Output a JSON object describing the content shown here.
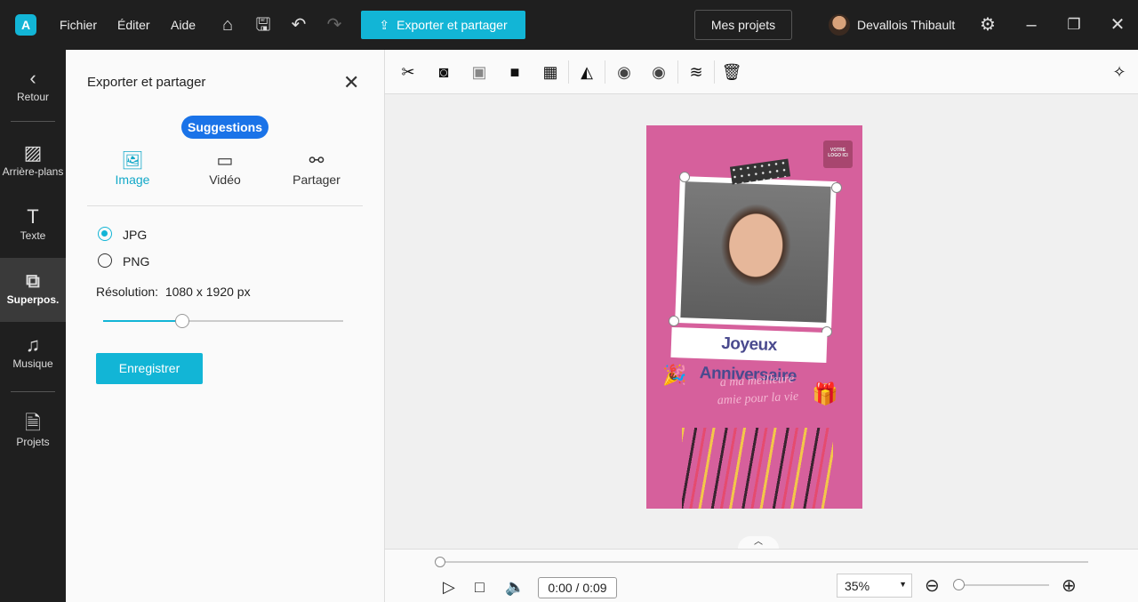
{
  "topbar": {
    "menu": [
      "Fichier",
      "Éditer",
      "Aide"
    ],
    "export_label": "Exporter et partager",
    "projects_label": "Mes projets",
    "user_name": "Devallois Thibault"
  },
  "sidebar": {
    "items": [
      {
        "label": "Retour",
        "icon": "chevron-left-icon"
      },
      {
        "label": "Arrière-plans",
        "icon": "hatch-icon"
      },
      {
        "label": "Texte",
        "icon": "text-icon"
      },
      {
        "label": "Superpos.",
        "icon": "overlay-icon",
        "active": true
      },
      {
        "label": "Musique",
        "icon": "music-icon"
      },
      {
        "label": "Projets",
        "icon": "document-icon"
      }
    ]
  },
  "panel": {
    "title": "Exporter et partager",
    "suggestions_label": "Suggestions",
    "tabs": [
      {
        "label": "Image",
        "active": true
      },
      {
        "label": "Vidéo"
      },
      {
        "label": "Partager"
      }
    ],
    "formats": [
      {
        "label": "JPG",
        "selected": true
      },
      {
        "label": "PNG",
        "selected": false
      }
    ],
    "resolution_label": "Résolution:",
    "resolution_value": "1080 x 1920 px",
    "resolution_slider_percent": 33,
    "save_label": "Enregistrer"
  },
  "canvas": {
    "logo_placeholder": "VOTRE LOGO ICI",
    "banner": "Joyeux Anniversaire",
    "subtitle_line1": "a ma meilleure",
    "subtitle_line2": "amie pour la vie"
  },
  "playback": {
    "time": "0:00 / 0:09",
    "zoom": "35%",
    "progress_percent": 0
  },
  "colors": {
    "accent": "#12b5d6",
    "suggestion_badge": "#1a73e8",
    "card_background": "#d6609c",
    "banner_text": "#4a4a8e"
  }
}
